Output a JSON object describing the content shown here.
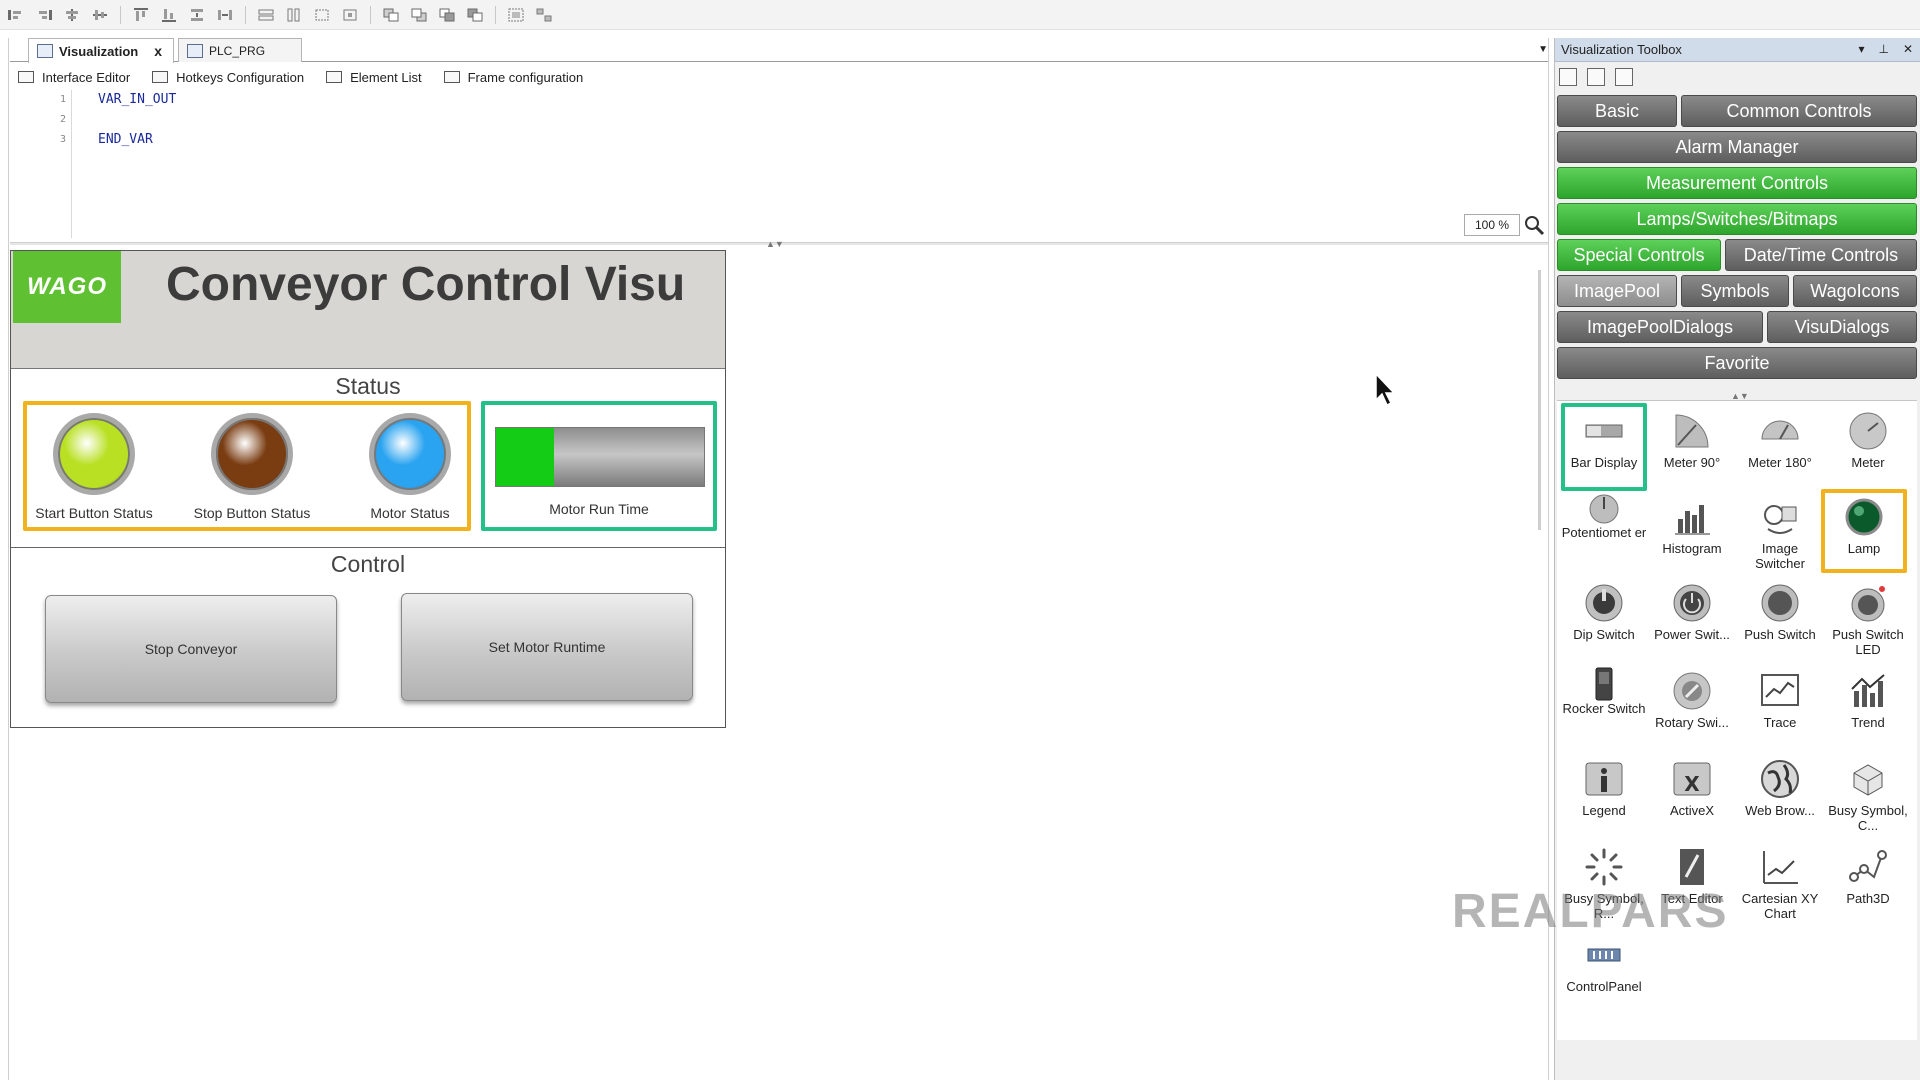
{
  "tabs": [
    {
      "label": "Visualization",
      "close": "x"
    },
    {
      "label": "PLC_PRG"
    }
  ],
  "subtabs": [
    "Interface Editor",
    "Hotkeys Configuration",
    "Element List",
    "Frame configuration"
  ],
  "code": {
    "line_numbers": [
      "1",
      "2",
      "3"
    ],
    "lines": [
      "VAR_IN_OUT",
      "",
      "END_VAR"
    ]
  },
  "zoom": "100 %",
  "visu": {
    "logo": "WAGO",
    "title": "Conveyor Control Visu",
    "status_label": "Status",
    "lamps": [
      {
        "caption": "Start Button Status",
        "color": "#b9e023"
      },
      {
        "caption": "Stop Button Status",
        "color": "#7a3d12"
      },
      {
        "caption": "Motor Status",
        "color": "#2aa3f0"
      }
    ],
    "bar_caption": "Motor Run Time",
    "bar_fill_fraction": 0.28,
    "control_label": "Control",
    "buttons": [
      "Stop Conveyor",
      "Set Motor Runtime"
    ],
    "highlight_yellow": "#f2b21e",
    "highlight_green": "#24c08a"
  },
  "toolbox": {
    "title": "Visualization Toolbox",
    "title_controls": [
      "▾",
      "⊥",
      "✕"
    ],
    "categories": [
      {
        "label": "Basic",
        "style": "gray"
      },
      {
        "label": "Common Controls",
        "style": "gray"
      },
      {
        "label": "Alarm Manager",
        "style": "gray"
      },
      {
        "label": "Measurement Controls",
        "style": "green"
      },
      {
        "label": "Lamps/Switches/Bitmaps",
        "style": "green"
      },
      {
        "label": "Special Controls",
        "style": "green"
      },
      {
        "label": "Date/Time Controls",
        "style": "gray"
      },
      {
        "label": "ImagePool",
        "style": "light"
      },
      {
        "label": "Symbols",
        "style": "gray"
      },
      {
        "label": "WagoIcons",
        "style": "gray"
      },
      {
        "label": "ImagePoolDialogs",
        "style": "gray"
      },
      {
        "label": "VisuDialogs",
        "style": "gray"
      },
      {
        "label": "Favorite",
        "style": "gray"
      }
    ],
    "elements": [
      {
        "label": "Bar Display",
        "icon": "bar-display-icon"
      },
      {
        "label": "Meter 90°",
        "icon": "meter-90-icon"
      },
      {
        "label": "Meter 180°",
        "icon": "meter-180-icon"
      },
      {
        "label": "Meter",
        "icon": "meter-icon"
      },
      {
        "label": "Potentiomet er",
        "icon": "potentiometer-icon"
      },
      {
        "label": "Histogram",
        "icon": "histogram-icon"
      },
      {
        "label": "Image Switcher",
        "icon": "image-switcher-icon"
      },
      {
        "label": "Lamp",
        "icon": "lamp-icon"
      },
      {
        "label": "Dip Switch",
        "icon": "dip-switch-icon"
      },
      {
        "label": "Power Swit...",
        "icon": "power-switch-icon"
      },
      {
        "label": "Push Switch",
        "icon": "push-switch-icon"
      },
      {
        "label": "Push Switch LED",
        "icon": "push-switch-led-icon"
      },
      {
        "label": "Rocker Switch",
        "icon": "rocker-switch-icon"
      },
      {
        "label": "Rotary Swi...",
        "icon": "rotary-switch-icon"
      },
      {
        "label": "Trace",
        "icon": "trace-icon"
      },
      {
        "label": "Trend",
        "icon": "trend-icon"
      },
      {
        "label": "Legend",
        "icon": "legend-icon"
      },
      {
        "label": "ActiveX",
        "icon": "activex-icon"
      },
      {
        "label": "Web Brow...",
        "icon": "web-browser-icon"
      },
      {
        "label": "Busy Symbol, C...",
        "icon": "busy-symbol-c-icon"
      },
      {
        "label": "Busy Symbol, R...",
        "icon": "busy-symbol-r-icon"
      },
      {
        "label": "Text Editor",
        "icon": "text-editor-icon"
      },
      {
        "label": "Cartesian XY Chart",
        "icon": "cartesian-xy-chart-icon"
      },
      {
        "label": "Path3D",
        "icon": "path3d-icon"
      },
      {
        "label": "ControlPanel",
        "icon": "control-panel-icon"
      }
    ]
  },
  "watermark": "REALPARS"
}
